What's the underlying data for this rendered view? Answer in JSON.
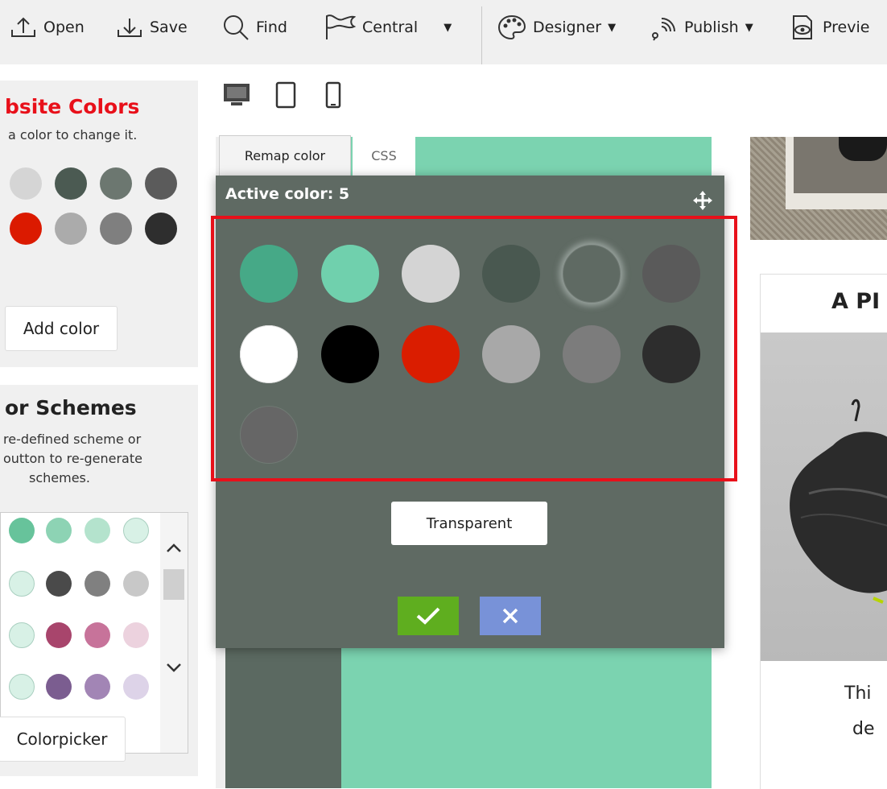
{
  "toolbar": {
    "open": "Open",
    "save": "Save",
    "find": "Find",
    "central": "Central",
    "designer": "Designer",
    "publish": "Publish",
    "preview": "Previe"
  },
  "website_colors": {
    "title": "bsite Colors",
    "subtitle": "a color to change it.",
    "swatches": [
      "#d5d5d5",
      "#4b5a52",
      "#6c7770",
      "#5b5b5b",
      "#db1a00",
      "#ababab",
      "#7f7f7f",
      "#2e2e2e"
    ],
    "add_color": "Add color"
  },
  "color_schemes": {
    "title": "or Schemes",
    "line1": "re-defined scheme or",
    "line2": "outton to re-generate",
    "line3": "schemes.",
    "rows": [
      [
        "#67c39b",
        "#8dd3b4",
        "#b4e3cd",
        "#d8f1e6"
      ],
      [
        "#d8f1e6",
        "#4a4a4a",
        "#808080",
        "#c8c8c8"
      ],
      [
        "#d8f1e6",
        "#a8456c",
        "#c7739a",
        "#ecd2de"
      ],
      [
        "#d8f1e6",
        "#7b5d90",
        "#a285b5",
        "#ddd3e8"
      ]
    ],
    "colorpicker": "Colorpicker"
  },
  "tabs": {
    "remap": "Remap color",
    "css": "CSS"
  },
  "dialog": {
    "title": "Active color: 5",
    "swatches": [
      "#46a987",
      "#70d0ad",
      "#d4d4d4",
      "#495850",
      "#5f6a63",
      "#5a5a5a",
      "#ffffff",
      "#000000",
      "#da1d00",
      "#a8a8a8",
      "#7c7c7c",
      "#2d2d2d",
      "#666666"
    ],
    "active_index": 4,
    "transparent": "Transparent",
    "ok_color": "#5fae1f",
    "cancel_color": "#7892d8"
  },
  "content": {
    "heading": "A PI",
    "text1": "Thi",
    "text2": "de"
  },
  "colors": {
    "accent_red": "#e8101a"
  }
}
